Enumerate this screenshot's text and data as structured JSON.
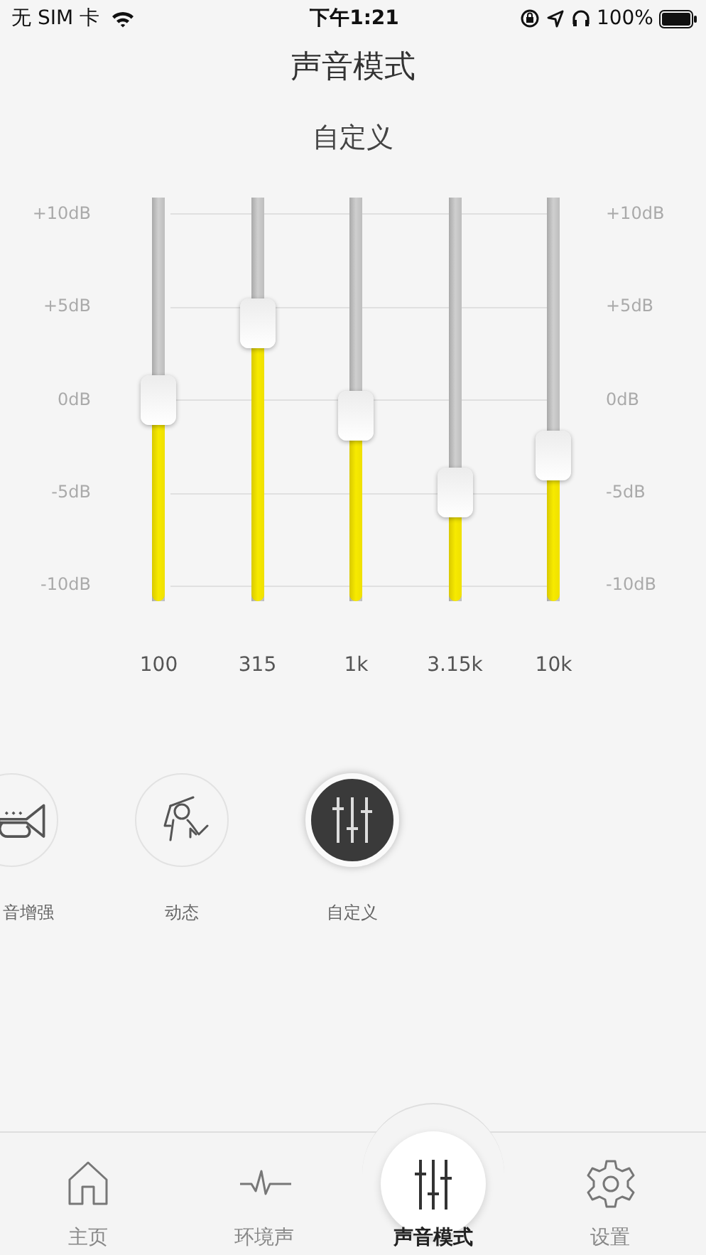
{
  "status_bar": {
    "carrier": "无 SIM 卡",
    "time": "下午1:21",
    "battery": "100%"
  },
  "title": "声音模式",
  "preset_name": "自定义",
  "eq": {
    "left_scale": [
      "+10dB",
      "+5dB",
      "0dB",
      "-5dB",
      "-10dB"
    ],
    "right_scale": [
      "+10dB",
      "+5dB",
      "0dB",
      "-5dB",
      "-10dB"
    ],
    "bands": [
      {
        "label": "100",
        "level": 0.5
      },
      {
        "label": "315",
        "level": 0.69
      },
      {
        "label": "1k",
        "level": 0.46
      },
      {
        "label": "3.15k",
        "level": 0.27
      },
      {
        "label": "10k",
        "level": 0.36
      }
    ]
  },
  "modes": [
    {
      "kind": "trumpet",
      "label": "音增强",
      "selected": false
    },
    {
      "kind": "dynamic",
      "label": "动态",
      "selected": false
    },
    {
      "kind": "custom",
      "label": "自定义",
      "selected": true
    }
  ],
  "tabs": [
    {
      "kind": "home",
      "label": "主页",
      "selected": false
    },
    {
      "kind": "ambient",
      "label": "环境声",
      "selected": false
    },
    {
      "kind": "mode",
      "label": "声音模式",
      "selected": true
    },
    {
      "kind": "settings",
      "label": "设置",
      "selected": false
    }
  ]
}
